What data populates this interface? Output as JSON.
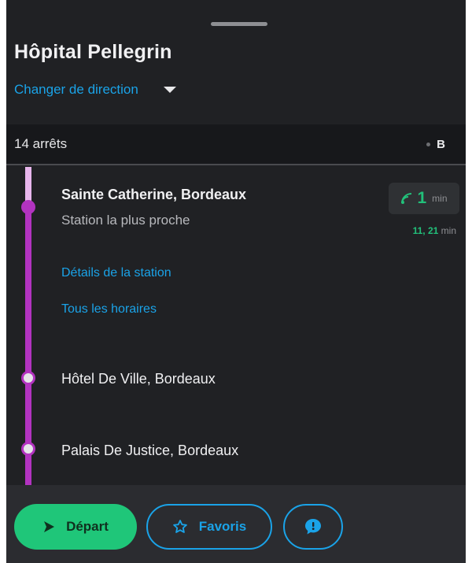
{
  "header": {
    "title": "Hôpital Pellegrin",
    "change_direction": "Changer de direction"
  },
  "stops_header": {
    "count_label": "14 arrêts",
    "line_label": "B"
  },
  "current_stop": {
    "name": "Sainte Catherine, Bordeaux",
    "subtitle": "Station la plus proche",
    "eta_value": "1",
    "eta_unit": "min",
    "next_times": "11, 21",
    "next_unit": "min",
    "details_link": "Détails de la station",
    "schedules_link": "Tous les horaires"
  },
  "stops": [
    {
      "name": "Hôtel De Ville, Bordeaux"
    },
    {
      "name": "Palais De Justice, Bordeaux"
    }
  ],
  "footer": {
    "depart_label": "Départ",
    "favorites_label": "Favoris"
  },
  "colors": {
    "accent_blue": "#1aa3e8",
    "accent_green": "#1fc679",
    "line_purple": "#b233c0",
    "background": "#202124"
  },
  "icons": [
    "chevron-down-icon",
    "realtime-signal-icon",
    "play-arrow-icon",
    "star-icon",
    "chat-bubble-icon"
  ]
}
